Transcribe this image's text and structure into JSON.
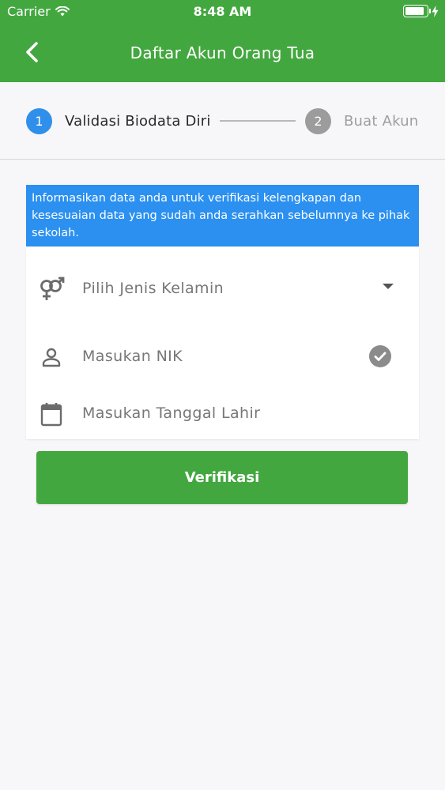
{
  "status_bar": {
    "carrier": "Carrier",
    "time": "8:48 AM",
    "battery_level": 0.9
  },
  "nav": {
    "title": "Daftar Akun Orang Tua",
    "back_icon": "chevron-left-icon"
  },
  "stepper": {
    "steps": [
      {
        "number": "1",
        "label": "Validasi Biodata Diri",
        "active": true
      },
      {
        "number": "2",
        "label": "Buat Akun",
        "active": false
      }
    ]
  },
  "info_banner": {
    "text": "Informasikan data anda untuk verifikasi kelengkapan dan kesesuaian data yang sudah anda serahkan sebelumnya ke pihak sekolah."
  },
  "form": {
    "gender": {
      "placeholder": "Pilih Jenis Kelamin",
      "icon": "gender-icon"
    },
    "nik": {
      "placeholder": "Masukan NIK",
      "icon": "person-icon",
      "status_icon": "check-circle-icon"
    },
    "birthdate": {
      "placeholder": "Masukan Tanggal Lahir",
      "icon": "calendar-icon"
    }
  },
  "actions": {
    "verify_label": "Verifikasi"
  },
  "colors": {
    "primary_green": "#43a73f",
    "accent_blue": "#2b90f0",
    "inactive_gray": "#9c9c9c"
  }
}
